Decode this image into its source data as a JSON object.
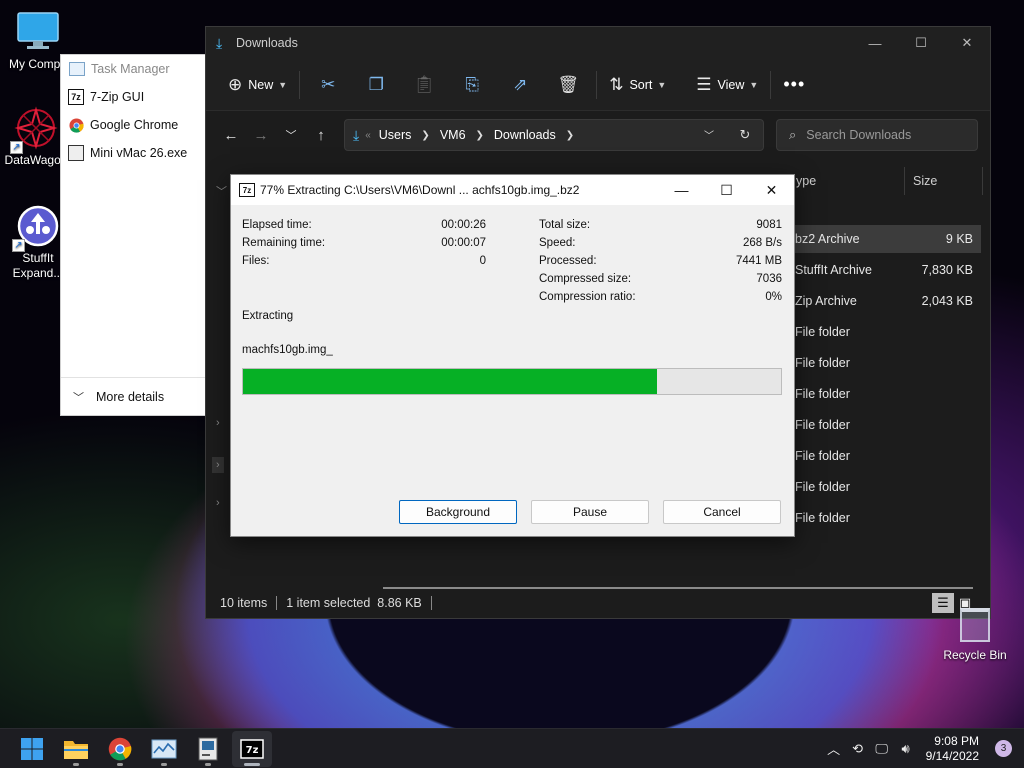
{
  "desktop": {
    "icons": [
      {
        "label": "My Compu",
        "icon": "monitor-icon"
      },
      {
        "label": "DataWagon",
        "icon": "datawagon-icon"
      },
      {
        "label": "StuffIt Expand...",
        "icon": "stuffit-icon"
      }
    ],
    "recycle_bin": "Recycle Bin"
  },
  "task_manager": {
    "title": "Task Manager",
    "items": [
      {
        "label": "7-Zip GUI",
        "icon": "7zip-icon"
      },
      {
        "label": "Google Chrome",
        "icon": "chrome-icon"
      },
      {
        "label": "Mini vMac 26.exe",
        "icon": "minivmac-icon"
      }
    ],
    "more_details": "More details"
  },
  "explorer": {
    "title": "Downloads",
    "toolbar": {
      "new_label": "New",
      "sort_label": "Sort",
      "view_label": "View"
    },
    "address": {
      "crumbs": [
        "Users",
        "VM6",
        "Downloads"
      ],
      "prefix": "«"
    },
    "search_placeholder": "Search Downloads",
    "columns": {
      "type": "ype",
      "size": "Size"
    },
    "rows": [
      {
        "type": "bz2 Archive",
        "size": "9 KB",
        "selected": true
      },
      {
        "type": "StuffIt Archive",
        "size": "7,830 KB"
      },
      {
        "type": "Zip Archive",
        "size": "2,043 KB"
      },
      {
        "type": "File folder",
        "size": ""
      },
      {
        "type": "File folder",
        "size": ""
      },
      {
        "type": "File folder",
        "size": ""
      },
      {
        "type": "File folder",
        "size": ""
      },
      {
        "type": "File folder",
        "size": ""
      },
      {
        "type": "File folder",
        "size": ""
      },
      {
        "type": "File folder",
        "size": ""
      }
    ],
    "status": {
      "count": "10 items",
      "selection": "1 item selected  8.86 KB"
    }
  },
  "dialog": {
    "title": "77% Extracting C:\\Users\\VM6\\Downl ... achfs10gb.img_.bz2",
    "left_stats": [
      {
        "label": "Elapsed time:",
        "value": "00:00:26"
      },
      {
        "label": "Remaining time:",
        "value": "00:00:07"
      },
      {
        "label": "Files:",
        "value": "0"
      }
    ],
    "right_stats": [
      {
        "label": "Total size:",
        "value": "9081"
      },
      {
        "label": "Speed:",
        "value": "268 B/s"
      },
      {
        "label": "Processed:",
        "value": "7441 MB"
      },
      {
        "label": "Compressed size:",
        "value": "7036"
      },
      {
        "label": "Compression ratio:",
        "value": "0%"
      }
    ],
    "operation": "Extracting",
    "current_file": "machfs10gb.img_",
    "progress_fraction": 0.77,
    "progress_color": "#06b025",
    "buttons": {
      "background": "Background",
      "pause": "Pause",
      "cancel": "Cancel"
    }
  },
  "taskbar": {
    "apps": [
      "start-icon",
      "file-explorer-icon",
      "chrome-icon",
      "task-manager-icon",
      "minivmac-icon",
      "7zip-icon"
    ],
    "clock_time": "9:08 PM",
    "clock_date": "9/14/2022",
    "notification_count": "3"
  }
}
